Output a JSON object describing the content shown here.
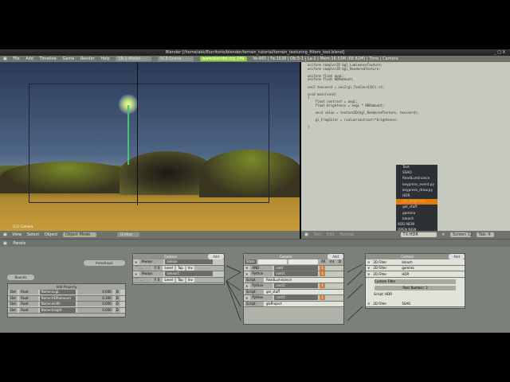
{
  "window": {
    "title": "Blender [/home/akk/Escritorio/blender/terrain_tutorial/terrain_texturing_filters_test.blend]",
    "controls": "_ □ X"
  },
  "menubar": {
    "items": [
      "File",
      "Add",
      "Timeline",
      "Game",
      "Render",
      "Help"
    ],
    "screen": "SR:1-Model",
    "scene": "SCE:Scene",
    "site": "www.blender.org 249",
    "stats": "Ve:665 | Fa:1638 | Ob:5-1 | La:2 | Mem:16.53M (68.82M) | Time | Camera"
  },
  "viewport": {
    "label": "(11) Camera"
  },
  "code": [
    "uniform sampler2D bgl_LuminanceTexture;",
    "uniform sampler2D bgl_RenderedTexture;",
    "",
    "uniform float avgL;",
    "uniform float HDRamount;",
    "",
    "vec2 texcoord = vec2(gl_TexCoord[0]).st;",
    "",
    "void main(void)",
    "{",
    "    float contrast = avgL;",
    "    float brightness = avgL * HDRamount;",
    "",
    "    vec4 value = texture2D(bgl_RenderedTexture, texcoord);",
    "",
    "    gl_FragColor = (value/contrast)*brightness;",
    "",
    "}"
  ],
  "vp_header": {
    "menus": [
      "View",
      "Select",
      "Object"
    ],
    "mode": "Object Mode",
    "pivot": "Global"
  },
  "txt_header": {
    "menus": [
      "Text",
      "Edit",
      "Format"
    ],
    "textname": "TX:HDR",
    "screen": "Screen 12",
    "tab": "Tab: 4"
  },
  "text_menu": {
    "items": [
      "Text",
      "SSAO",
      "ReadLuminance",
      "keypress_event.py",
      "keypress_draw.py",
      "HDR",
      "gel_fragment",
      "gel_staff",
      "gamma",
      "bleach"
    ],
    "highlighted": 6,
    "commands": [
      "ADD NEW",
      "OPEN NEW"
    ]
  },
  "logic_header": {
    "label": "Panels"
  },
  "logic": {
    "actor_btn": "Anisotropic",
    "bounds_btn": "Bounds",
    "add_property": "Add Property",
    "properties": [
      {
        "del": "Del",
        "type": "Float",
        "name": "Name:avgL",
        "value": "0.000",
        "d": "D"
      },
      {
        "del": "Del",
        "type": "Float",
        "name": "Name:HDRamount",
        "value": "0.100",
        "d": "D"
      },
      {
        "del": "Del",
        "type": "Float",
        "name": "Name:width",
        "value": "0.000",
        "d": "D"
      },
      {
        "del": "Del",
        "type": "Float",
        "name": "Name:height",
        "value": "0.000",
        "d": "D"
      }
    ],
    "sensors": {
      "title": "Camera",
      "add": "Add",
      "items": [
        {
          "type": "Always",
          "name": "sensor",
          "level": "Level",
          "tap": "Tap",
          "inv": "Inv",
          "f": "f: 0"
        },
        {
          "type": "Always",
          "name": "sensor1",
          "level": "Level",
          "tap": "Tap",
          "inv": "Inv",
          "f": "f: 0"
        }
      ]
    },
    "controllers": {
      "title": "Camera",
      "add": "Add",
      "state": "State",
      "all": "All",
      "ini": "Ini",
      "d": "D",
      "items": [
        {
          "type": "AND",
          "name": "cont"
        },
        {
          "type": "Python",
          "name": "cont1",
          "script": "ReadLuminance"
        },
        {
          "type": "Python",
          "name": "cont2",
          "script": "gel_staff"
        },
        {
          "type": "Python",
          "name": "cont3",
          "script": "glsProject"
        }
      ],
      "script_label": "Script"
    },
    "actuators": {
      "title": "Camera",
      "add": "Add",
      "items": [
        {
          "type": "2D Filter",
          "name": "bleach"
        },
        {
          "type": "2D Filter",
          "name": "gamma"
        },
        {
          "type": "2D Filter",
          "name": "HDR"
        },
        {
          "type": "2D Filter",
          "name": "SSAO"
        }
      ],
      "filter": "Custom Filter",
      "pass": "Pass Number: 3",
      "script": "Script: HDR"
    }
  }
}
